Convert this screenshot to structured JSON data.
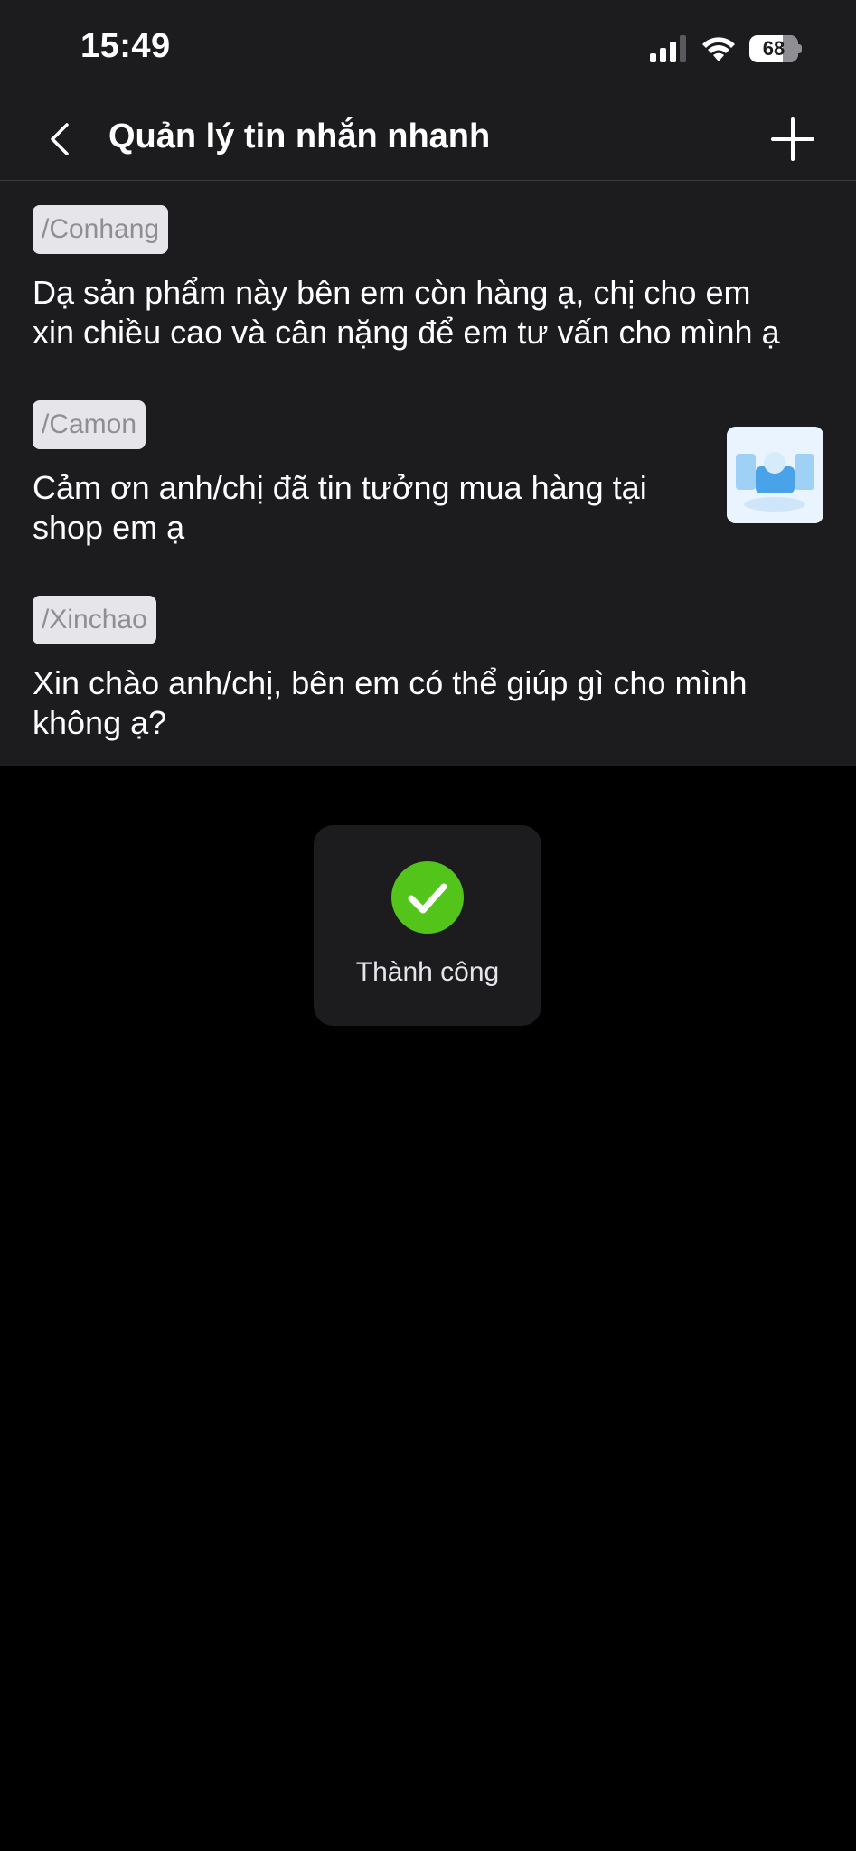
{
  "status_bar": {
    "time": "15:49",
    "battery_level": "68",
    "battery_fraction": 0.68
  },
  "nav": {
    "title": "Quản lý tin nhắn nhanh",
    "back_icon": "chevron-left-icon",
    "add_icon": "plus-icon"
  },
  "quick_messages": [
    {
      "shortcut": "/Conhang",
      "text_lines": [
        "Dạ sản phẩm này bên em còn hàng ạ, chị cho em",
        "xin chiều cao và cân nặng để em tư vấn cho mình ạ"
      ],
      "has_image": false
    },
    {
      "shortcut": "/Camon",
      "text_lines": [
        "Cảm ơn anh/chị đã tin tưởng mua hàng tại",
        "shop em ạ"
      ],
      "has_image": true
    },
    {
      "shortcut": "/Xinchao",
      "text_lines": [
        "Xin chào anh/chị, bên em có thể giúp gì cho mình",
        "không ạ?"
      ],
      "has_image": false
    }
  ],
  "toast": {
    "label": "Thành công",
    "icon": "check-circle-icon",
    "color": "#52c41a"
  },
  "colors": {
    "surface": "#1c1c1e",
    "background": "#000000",
    "tag_bg": "#e5e5ea",
    "tag_text": "#8e8e93",
    "success": "#52c41a"
  }
}
